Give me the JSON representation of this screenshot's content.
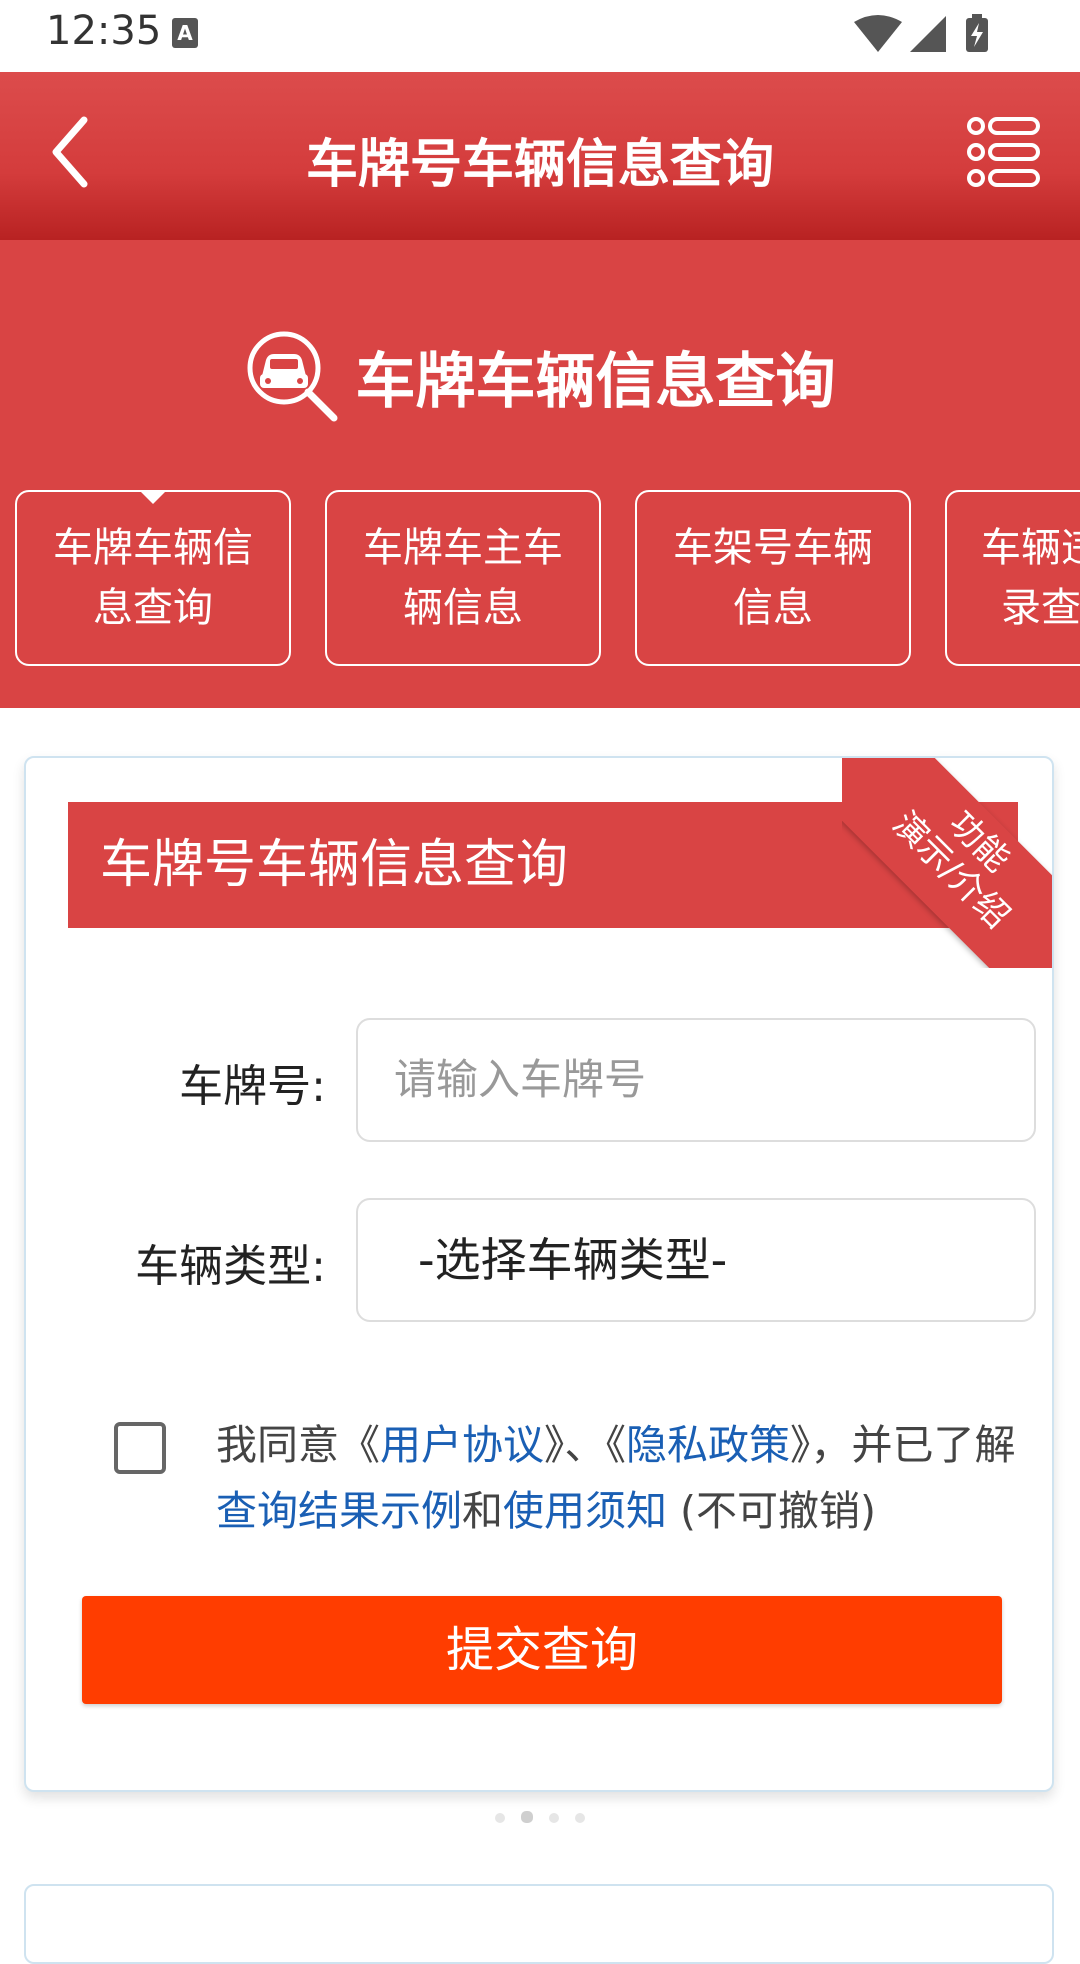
{
  "status_bar": {
    "time": "12:35",
    "badge": "A"
  },
  "header": {
    "title": "车牌号车辆信息查询",
    "back_icon": "chevron-left-icon",
    "menu_icon": "list-menu-icon"
  },
  "hero": {
    "title": "车牌车辆信息查询",
    "icon": "car-search-icon",
    "tabs": [
      {
        "line1": "车牌车辆信",
        "line2": "息查询",
        "active": true
      },
      {
        "line1": "车牌车主车",
        "line2": "辆信息",
        "active": false
      },
      {
        "line1": "车架号车辆",
        "line2": "信息",
        "active": false
      },
      {
        "line1": "车辆违",
        "line2": "录查",
        "active": false
      }
    ]
  },
  "card": {
    "header_title": "车牌号车辆信息查询",
    "ribbon_line1": "功能",
    "ribbon_line2": "演示/介绍",
    "plate_label": "车牌号:",
    "plate_placeholder": "请输入车牌号",
    "type_label": "车辆类型:",
    "type_value": "-选择车辆类型-",
    "agree": {
      "t1": "我同意《",
      "link1": "用户协议",
      "t2": "》、《",
      "link2": "隐私政策",
      "t3": "》，并已了解",
      "link3": "查询结果示例",
      "t4": "和",
      "link4": "使用须知",
      "t5": " (不可撤销)"
    },
    "submit_label": "提交查询"
  },
  "colors": {
    "primary_red": "#d94444",
    "submit_orange": "#ff3d00",
    "link_blue": "#1a5fb4"
  }
}
